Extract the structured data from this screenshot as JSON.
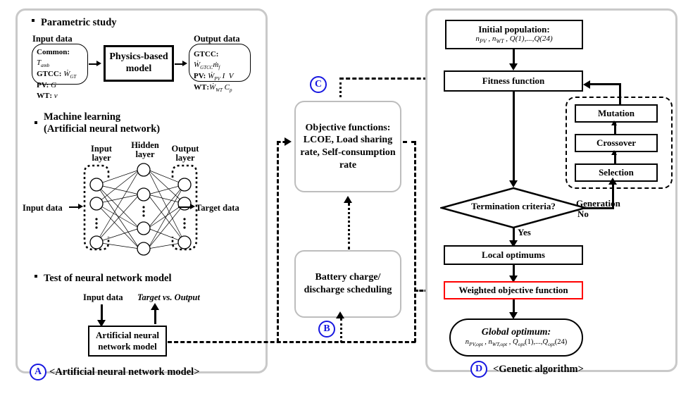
{
  "panels": {
    "ann": {
      "caption": "<Artificial neural network model>",
      "marker": "A",
      "sections": {
        "parametric": {
          "heading": "Parametric study",
          "input_title": "Input data",
          "input_rows": [
            "Common: T_amb",
            "GTCC: W_GT",
            "PV: G",
            "WT: v"
          ],
          "model_box": "Physics-based model",
          "output_title": "Output data",
          "output_rows": [
            "GTCC: W_GTCC, m_f",
            "PV: W_PV, I, V",
            "WT: W_WT, C_p"
          ]
        },
        "ml": {
          "heading_line1": "Machine learning",
          "heading_line2": "(Artificial neural network)",
          "layer_labels": [
            "Input layer",
            "Hidden layer",
            "Output layer"
          ],
          "left_label": "Input data",
          "right_label": "Target data"
        },
        "test": {
          "heading": "Test of neural network model",
          "input_label": "Input data",
          "output_label": "Target vs. Output",
          "box": "Artificial neural network model"
        }
      }
    },
    "middle": {
      "objective_marker": "C",
      "battery_marker": "B",
      "objective_box": "Objective functions: LCOE, Load sharing rate, Self-consumption rate",
      "battery_box": "Battery charge/ discharge scheduling"
    },
    "ga": {
      "caption": "<Genetic algorithm>",
      "marker": "D",
      "initial_population_title": "Initial population:",
      "initial_population_vars": "n_PV , n_WT , Q(1),...,Q(24)",
      "fitness": "Fitness function",
      "operators": [
        "Mutation",
        "Crossover",
        "Selection"
      ],
      "decision": "Termination criteria?",
      "branch_no": "No",
      "branch_yes": "Yes",
      "generation_label": "Generation",
      "local_optimums": "Local optimums",
      "weighted": "Weighted objective function",
      "global_title": "Global optimum:",
      "global_vars": "n_PV,opt , n_WT,opt , Q_opt(1),...,Q_opt(24)"
    }
  },
  "colors": {
    "panel_border": "#c9c9c9",
    "marker_blue": "#1717e0",
    "highlight_red": "#ff0000",
    "soft_border": "#bdbdbd"
  }
}
